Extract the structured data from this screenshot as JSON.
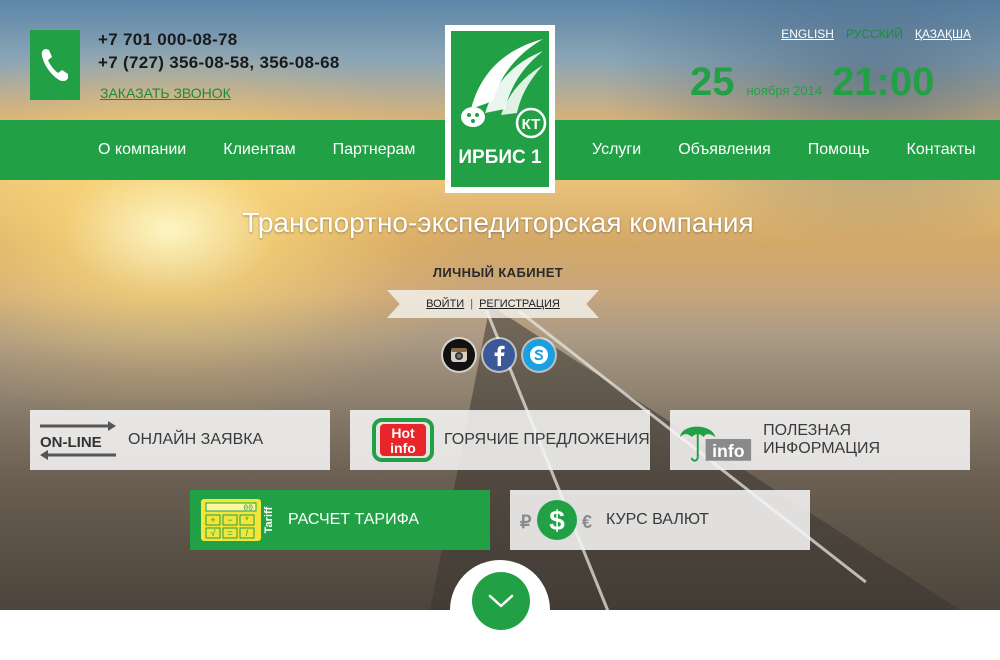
{
  "header": {
    "phones": [
      "+7 701 000-08-78",
      "+7 (727) 356-08-58, 356-08-68"
    ],
    "callback_label": "ЗАКАЗАТЬ ЗВОНОК",
    "phone_icon": "phone-icon"
  },
  "languages": [
    {
      "label": "ENGLISH",
      "active": false
    },
    {
      "label": "РУССКИЙ",
      "active": true
    },
    {
      "label": "ҚАЗАҚША",
      "active": false
    }
  ],
  "datetime": {
    "day": "25",
    "month_year": "ноября 2014",
    "time": "21:00"
  },
  "logo": {
    "text": "ИРБИС 1",
    "badge": "КТ"
  },
  "nav": {
    "left": [
      "О компании",
      "Клиентам",
      "Партнерам"
    ],
    "right": [
      "Услуги",
      "Объявления",
      "Помощь",
      "Контакты"
    ]
  },
  "hero": {
    "tagline": "Транспортно-экспедиторская компания",
    "cabinet_title": "ЛИЧНЫЙ КАБИНЕТ",
    "login_label": "ВОЙТИ",
    "separator": "|",
    "register_label": "РЕГИСТРАЦИЯ"
  },
  "social": [
    "instagram-icon",
    "facebook-icon",
    "skype-icon"
  ],
  "tiles": {
    "online": {
      "icon_text": "ON-LINE",
      "label": "ОНЛАЙН ЗАЯВКА"
    },
    "hot": {
      "icon_text_1": "Hot",
      "icon_text_2": "info",
      "label": "ГОРЯЧИЕ ПРЕДЛОЖЕНИЯ"
    },
    "info": {
      "icon_text": "info",
      "label": "ПОЛЕЗНАЯ ИНФОРМАЦИЯ"
    },
    "tariff": {
      "icon_text": "Tariff",
      "display": "00",
      "label": "РАСЧЕТ ТАРИФА"
    },
    "currency": {
      "left_symbol": "₽",
      "center_symbol": "$",
      "right_symbol": "€",
      "label": "КУРС ВАЛЮТ"
    }
  },
  "colors": {
    "brand_green": "#22a046"
  }
}
